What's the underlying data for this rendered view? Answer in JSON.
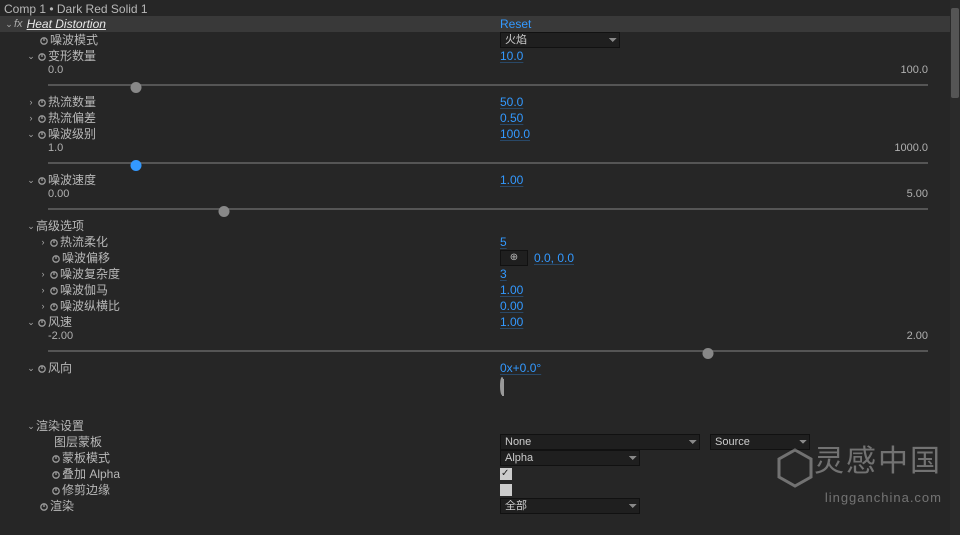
{
  "title": "Comp 1 • Dark Red Solid 1",
  "effect": {
    "name": "Heat Distortion",
    "reset": "Reset"
  },
  "noise_mode": {
    "label": "噪波模式",
    "value": "火焰"
  },
  "distort_amount": {
    "label": "变形数量",
    "value": "10.0"
  },
  "distort_slider": {
    "min": "0.0",
    "max": "100.0",
    "pct": 10
  },
  "heat_flow": {
    "label": "热流数量",
    "value": "50.0"
  },
  "heat_bias": {
    "label": "热流偏差",
    "value": "0.50"
  },
  "noise_level": {
    "label": "噪波级别",
    "value": "100.0"
  },
  "noise_slider": {
    "min": "1.0",
    "max": "1000.0",
    "pct": 10
  },
  "noise_speed": {
    "label": "噪波速度",
    "value": "1.00"
  },
  "speed_slider": {
    "min": "0.00",
    "max": "5.00",
    "pct": 20
  },
  "adv": {
    "label": "高级选项",
    "softness": {
      "label": "热流柔化",
      "value": "5"
    },
    "offset": {
      "label": "噪波偏移",
      "value": "0.0, 0.0"
    },
    "complexity": {
      "label": "噪波复杂度",
      "value": "3"
    },
    "gamma": {
      "label": "噪波伽马",
      "value": "1.00"
    },
    "aspect": {
      "label": "噪波纵横比",
      "value": "0.00"
    }
  },
  "wind_speed": {
    "label": "风速",
    "value": "1.00"
  },
  "wind_slider": {
    "min": "-2.00",
    "max": "2.00",
    "pct": 75
  },
  "wind_dir": {
    "label": "风向",
    "value": "0x+0.0°"
  },
  "render": {
    "label": "渲染设置",
    "layer_mask": {
      "label": "图层蒙板",
      "value": "None",
      "src_label": "Source"
    },
    "mask_mode": {
      "label": "蒙板模式",
      "value": "Alpha"
    },
    "overlay_alpha": {
      "label": "叠加 Alpha",
      "checked": true
    },
    "clip_edges": {
      "label": "修剪边缘",
      "checked": false
    },
    "render_sel": {
      "label": "渲染",
      "value": "全部"
    }
  },
  "watermark": {
    "text1": "灵感中国",
    "text2": "lingganchina.com"
  }
}
